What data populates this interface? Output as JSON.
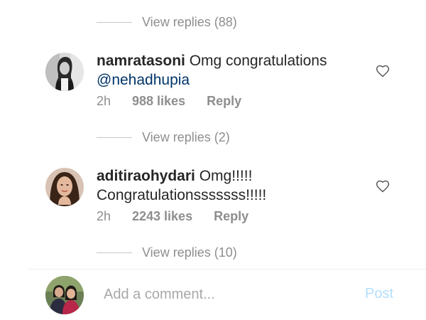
{
  "threads": [
    {
      "view_replies": "View replies (88)"
    },
    {
      "view_replies": "View replies (2)"
    },
    {
      "view_replies": "View replies (10)"
    }
  ],
  "comments": [
    {
      "username": "namratasoni",
      "text": "Omg congratulations",
      "mention": "@nehadhupia",
      "time": "2h",
      "likes": "988 likes",
      "reply_label": "Reply",
      "avatar_icon": "profile-photo-icon"
    },
    {
      "username": "aditiraohydari",
      "text": "Omg!!!!!",
      "text_line2": "Congratulationsssssss!!!!!",
      "time": "2h",
      "likes": "2243 likes",
      "reply_label": "Reply",
      "avatar_icon": "profile-photo-icon"
    }
  ],
  "composer": {
    "placeholder": "Add a comment...",
    "post_label": "Post",
    "post_color": "#b2dffc"
  },
  "colors": {
    "muted_text": "#8e8e8e",
    "mention": "#003569",
    "primary_text": "#262626"
  }
}
